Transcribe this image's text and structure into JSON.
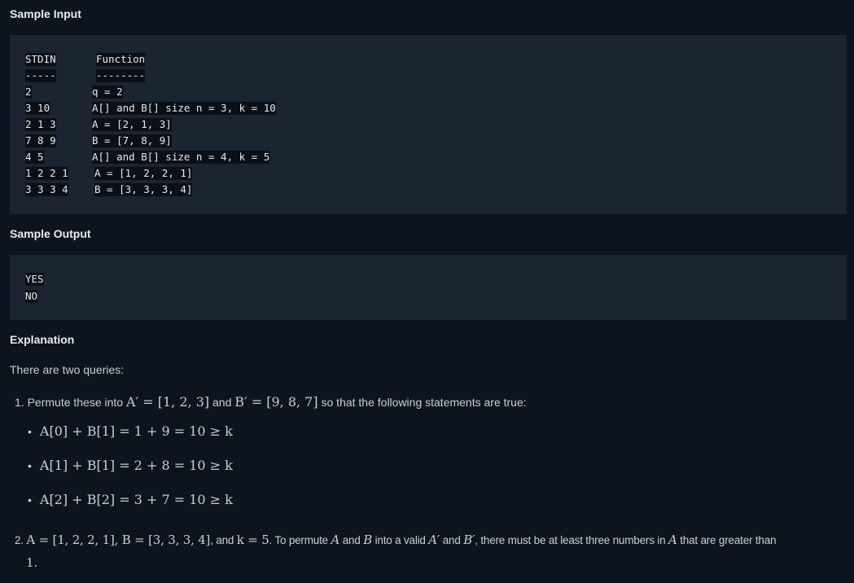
{
  "sample_input": {
    "title": "Sample Input",
    "lines": [
      {
        "left": "STDIN",
        "right": "Function"
      },
      {
        "left": "-----",
        "right": "--------"
      },
      {
        "left": "2",
        "right": "q = 2"
      },
      {
        "left": "3 10",
        "right": "A[] and B[] size n = 3, k = 10"
      },
      {
        "left": "2 1 3",
        "right": "A = [2, 1, 3]"
      },
      {
        "left": "7 8 9",
        "right": "B = [7, 8, 9]"
      },
      {
        "left": "4 5",
        "right": "A[] and B[] size n = 4, k = 5"
      },
      {
        "left": "1 2 2 1",
        "right": "A = [1, 2, 2, 1]"
      },
      {
        "left": "3 3 3 4",
        "right": "B = [3, 3, 3, 4]"
      }
    ]
  },
  "sample_output": {
    "title": "Sample Output",
    "lines": [
      "YES",
      "NO"
    ]
  },
  "explanation": {
    "title": "Explanation",
    "intro": "There are two queries:",
    "item1": {
      "num": "1.",
      "text_a": "Permute these into",
      "math_a": "A′ = [1, 2, 3]",
      "text_b": "and",
      "math_b": "B′ = [9, 8, 7]",
      "text_c": "so that the following statements are true:",
      "bullets": [
        "A[0] + B[1] = 1 + 9 = 10 ≥ k",
        "A[1] + B[1] = 2 + 8 = 10 ≥ k",
        "A[2] + B[2] = 3 + 7 = 10 ≥ k"
      ]
    },
    "item2": {
      "num": "2.",
      "math_a": "A = [1, 2, 2, 1], B = [3, 3, 3, 4]",
      "text_a": ", and",
      "math_b": "k = 5",
      "text_b": ". To permute",
      "math_c": "A",
      "text_c": "and",
      "math_d": "B",
      "text_d": "into a valid",
      "math_e": "A′",
      "text_e": "and",
      "math_f": "B′",
      "text_f": ", there must be at least three numbers in",
      "math_g": "A",
      "text_g": "that are greater than",
      "line2": "1."
    }
  }
}
